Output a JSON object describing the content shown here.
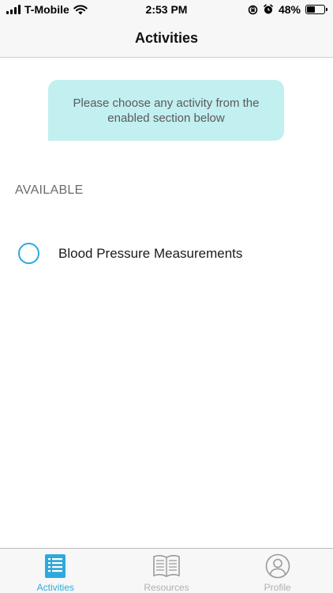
{
  "status_bar": {
    "carrier": "T-Mobile",
    "time": "2:53 PM",
    "battery_percent": "48%",
    "battery_level": 0.48,
    "icons": [
      "signal-icon",
      "wifi-icon",
      "orientation-lock-icon",
      "alarm-icon",
      "battery-icon"
    ]
  },
  "nav": {
    "title": "Activities"
  },
  "info_bubble": {
    "text": "Please choose any activity from the enabled section below"
  },
  "section": {
    "header": "AVAILABLE",
    "items": [
      {
        "label": "Blood Pressure Measurements",
        "icon": "radio-circle-icon"
      }
    ]
  },
  "tab_bar": {
    "tabs": [
      {
        "label": "Activities",
        "icon": "list-icon",
        "active": true
      },
      {
        "label": "Resources",
        "icon": "book-icon",
        "active": false
      },
      {
        "label": "Profile",
        "icon": "person-icon",
        "active": false
      }
    ]
  },
  "colors": {
    "accent": "#2ea9dd",
    "bubble": "#c2eff0",
    "inactive": "#b0b0b0",
    "bar_background": "#f7f7f7"
  }
}
